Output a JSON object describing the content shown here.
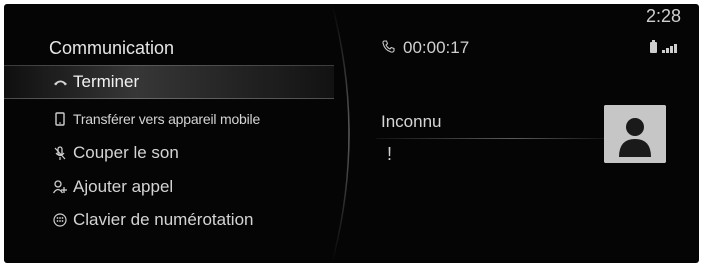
{
  "status": {
    "time": "2:28"
  },
  "menu": {
    "title": "Communication",
    "items": [
      {
        "label": "Terminer",
        "icon": "hang-up-icon",
        "selected": true
      },
      {
        "label": "Transférer vers appareil mobile",
        "icon": "mobile-device-icon",
        "selected": false
      },
      {
        "label": "Couper le son",
        "icon": "mute-mic-icon",
        "selected": false
      },
      {
        "label": "Ajouter appel",
        "icon": "add-call-icon",
        "selected": false
      },
      {
        "label": "Clavier de numérotation",
        "icon": "keypad-icon",
        "selected": false
      }
    ]
  },
  "call": {
    "duration": "00:00:17",
    "caller": "Inconnu",
    "caller_mark": "!"
  }
}
